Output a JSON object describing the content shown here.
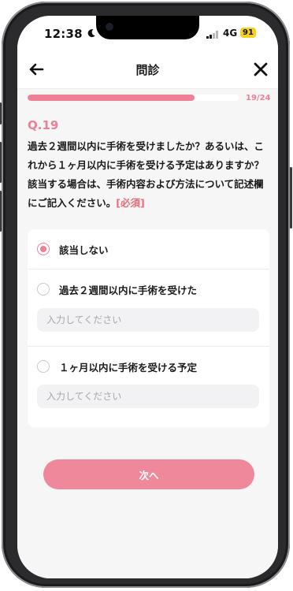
{
  "status": {
    "time": "12:38",
    "network": "4G",
    "battery": "91"
  },
  "nav": {
    "title": "問診"
  },
  "progress": {
    "text": "19/24",
    "fraction": 0.7917
  },
  "question": {
    "number": "Q.19",
    "text": "過去２週間以内に手術を受けましたか？あるいは、これから１ヶ月以内に手術を受ける予定はありますか？該当する場合は、手術内容および方法について記述欄にご記入ください。",
    "required": "[必須]"
  },
  "options": [
    {
      "label": "該当しない",
      "selected": true
    },
    {
      "label": "過去２週間以内に手術を受けた",
      "selected": false,
      "placeholder": "入力してください"
    },
    {
      "label": "１ヶ月以内に手術を受ける予定",
      "selected": false,
      "placeholder": "入力してください"
    }
  ],
  "next_label": "次へ",
  "colors": {
    "accent": "#ef7f95",
    "button": "#f0889c",
    "battery": "#f4d21c"
  }
}
